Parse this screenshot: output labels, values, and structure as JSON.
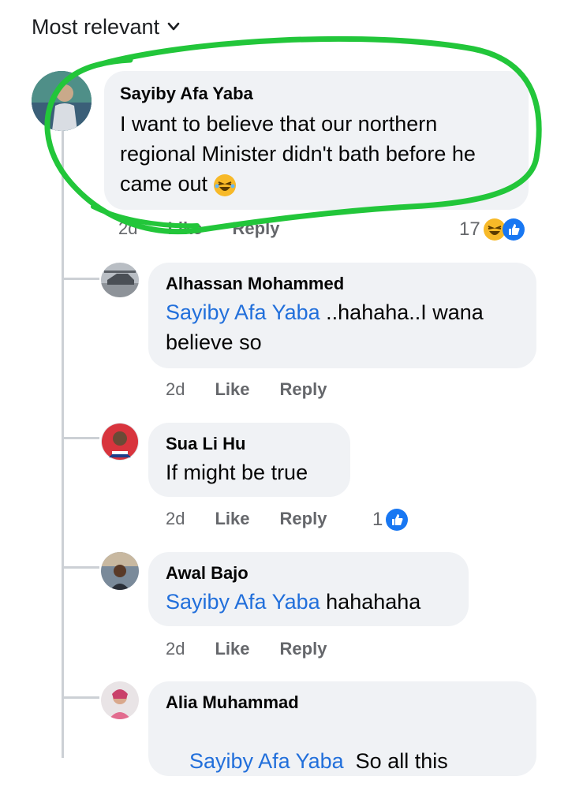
{
  "sort": {
    "label": "Most relevant"
  },
  "comments": [
    {
      "author": "Sayiby Afa Yaba",
      "text": "I want to believe that our northern regional Minister didn't bath before he came out",
      "time": "2d",
      "like": "Like",
      "reply": "Reply",
      "reactions": "17"
    },
    {
      "author": "Alhassan Mohammed",
      "mention": "Sayiby Afa Yaba",
      "text": " ..hahaha..I wana believe so",
      "time": "2d",
      "like": "Like",
      "reply": "Reply"
    },
    {
      "author": "Sua Li Hu",
      "text": "If might be true",
      "time": "2d",
      "like": "Like",
      "reply": "Reply",
      "reactions": "1"
    },
    {
      "author": "Awal Bajo",
      "mention": "Sayiby Afa Yaba",
      "text": " hahahaha",
      "time": "2d",
      "like": "Like",
      "reply": "Reply"
    },
    {
      "author": "Alia Muhammad",
      "mention": "Sayiby Afa Yaba",
      "text": "  So all this"
    }
  ],
  "colors": {
    "highlight": "#22c63a",
    "mention": "#216fdb",
    "bubble": "#f0f2f5"
  }
}
